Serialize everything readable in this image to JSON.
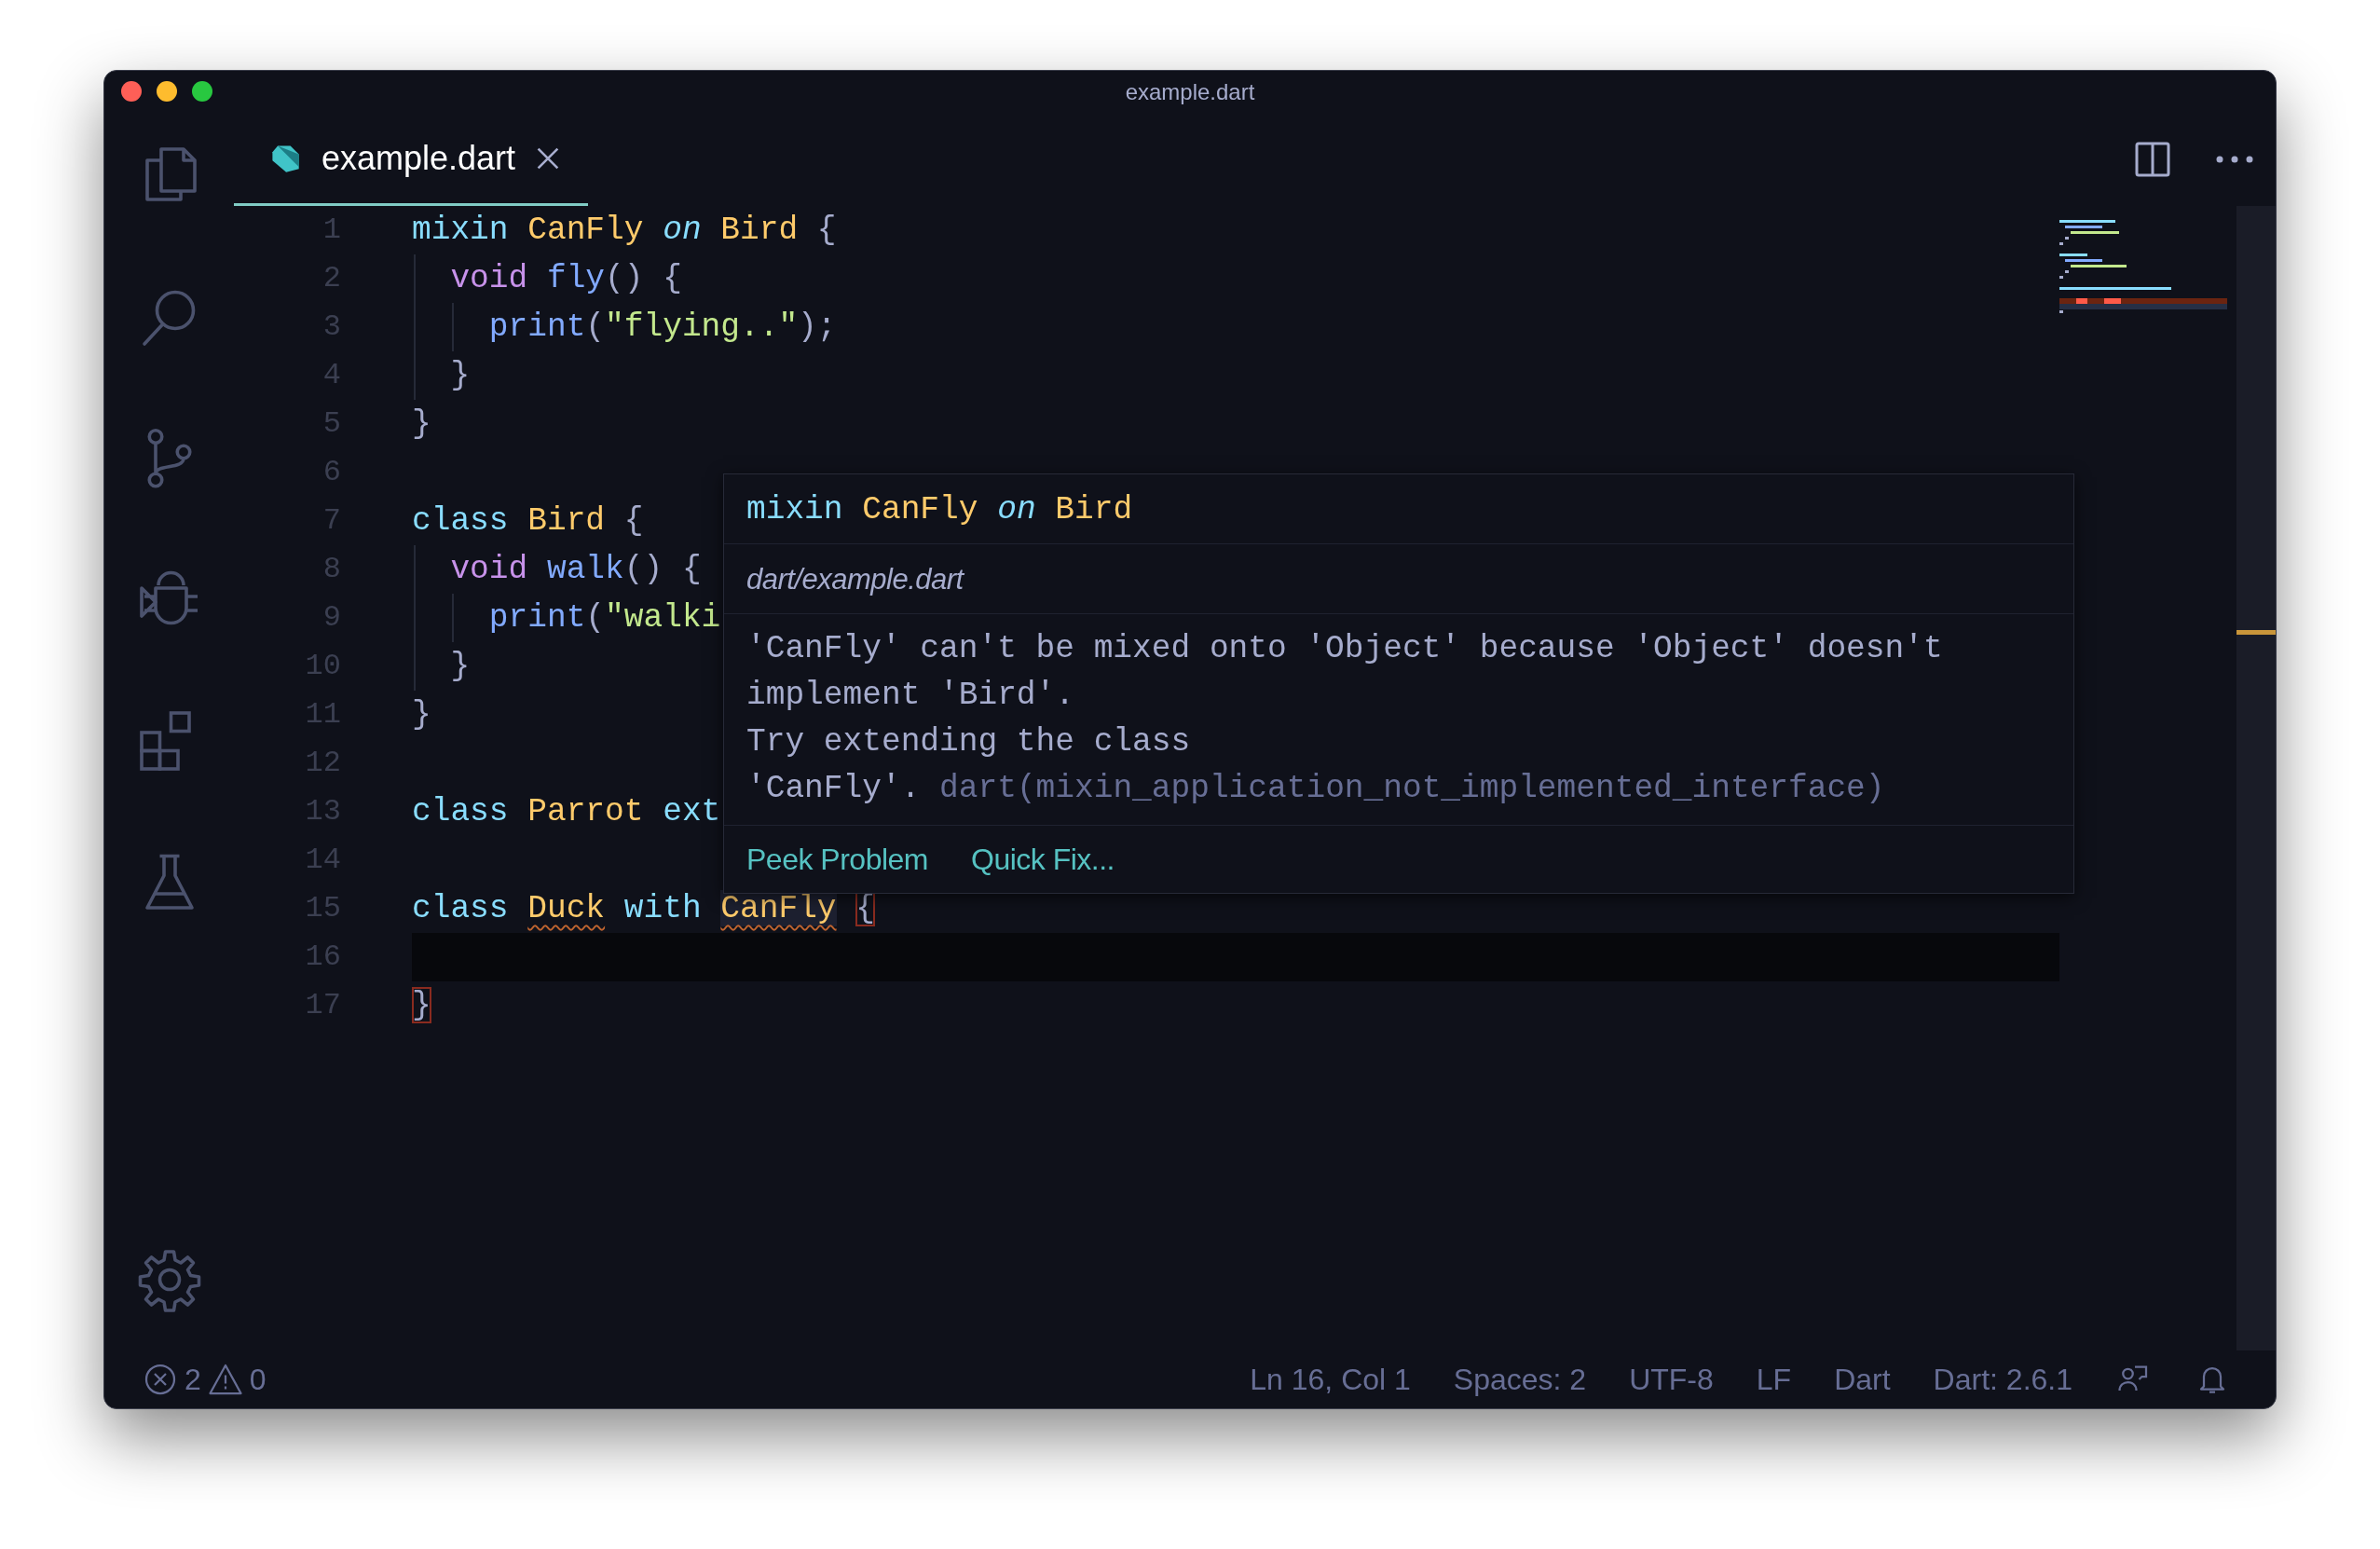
{
  "window": {
    "title": "example.dart"
  },
  "tabs": [
    {
      "label": "example.dart",
      "selected": true
    }
  ],
  "editor": {
    "lines": [
      {
        "number": "1",
        "current": false,
        "tokens": [
          {
            "t": "mixin ",
            "kind": "kw"
          },
          {
            "t": "CanFly ",
            "kind": "type"
          },
          {
            "t": "on",
            "kind": "mod"
          },
          {
            "t": " Bird",
            "kind": "type"
          },
          {
            "t": " {",
            "kind": "punct"
          }
        ]
      },
      {
        "number": "2",
        "current": false,
        "tokens": [
          {
            "t": "  void ",
            "kind": "void"
          },
          {
            "t": "fly",
            "kind": "fn"
          },
          {
            "t": "() {",
            "kind": "punct"
          }
        ]
      },
      {
        "number": "3",
        "current": false,
        "tokens": [
          {
            "t": "    print",
            "kind": "fn"
          },
          {
            "t": "(",
            "kind": "punct"
          },
          {
            "t": "\"flying..\"",
            "kind": "str"
          },
          {
            "t": ");",
            "kind": "punct"
          }
        ]
      },
      {
        "number": "4",
        "current": false,
        "tokens": [
          {
            "t": "  }",
            "kind": "punct"
          }
        ]
      },
      {
        "number": "5",
        "current": false,
        "tokens": [
          {
            "t": "}",
            "kind": "punct"
          }
        ]
      },
      {
        "number": "6",
        "current": false
      },
      {
        "number": "7",
        "current": false,
        "tokens": [
          {
            "t": "class ",
            "kind": "kw"
          },
          {
            "t": "Bird",
            "kind": "type"
          },
          {
            "t": " {",
            "kind": "punct"
          }
        ]
      },
      {
        "number": "8",
        "current": false,
        "tokens": [
          {
            "t": "  void ",
            "kind": "void"
          },
          {
            "t": "walk",
            "kind": "fn"
          },
          {
            "t": "() {",
            "kind": "punct"
          }
        ]
      },
      {
        "number": "9",
        "current": false,
        "tokens": [
          {
            "t": "    print",
            "kind": "fn"
          },
          {
            "t": "(",
            "kind": "punct"
          },
          {
            "t": "\"walki",
            "kind": "str"
          }
        ]
      },
      {
        "number": "10",
        "current": false,
        "tokens": [
          {
            "t": "  }",
            "kind": "punct"
          }
        ]
      },
      {
        "number": "11",
        "current": false,
        "tokens": [
          {
            "t": "}",
            "kind": "punct"
          }
        ]
      },
      {
        "number": "12",
        "current": false
      },
      {
        "number": "13",
        "current": false,
        "tokens": [
          {
            "t": "class ",
            "kind": "kw"
          },
          {
            "t": "Parrot ",
            "kind": "type"
          },
          {
            "t": "ext",
            "kind": "kw"
          }
        ]
      },
      {
        "number": "14",
        "current": false
      },
      {
        "number": "15",
        "current": false,
        "tokens": [
          {
            "t": "class ",
            "kind": "kw",
            "error": false,
            "hovered": false,
            "match": false
          },
          {
            "t": "Duck ",
            "kind": "type",
            "error": true,
            "hovered": false,
            "match": false
          },
          {
            "t": "with ",
            "kind": "kw",
            "error": false,
            "hovered": false,
            "match": false
          },
          {
            "t": "CanFly ",
            "kind": "type",
            "error": true,
            "hovered": true,
            "match": false
          },
          {
            "t": "{",
            "kind": "punct",
            "error": false,
            "hovered": false,
            "match": true
          }
        ]
      },
      {
        "number": "16",
        "current": true
      },
      {
        "number": "17",
        "current": false,
        "tokens": [
          {
            "t": "}",
            "kind": "punct",
            "error": false,
            "hovered": false,
            "match": true
          }
        ]
      }
    ]
  },
  "hover": {
    "signature": [
      {
        "t": "mixin ",
        "kind": "kw"
      },
      {
        "t": "CanFly ",
        "kind": "type"
      },
      {
        "t": "on",
        "kind": "mod"
      },
      {
        "t": " Bird",
        "kind": "type"
      }
    ],
    "path": "dart/example.dart",
    "message_lines": [
      "'CanFly' can't be mixed onto 'Object' because 'Object' doesn't",
      "implement 'Bird'.",
      "Try extending the class",
      "'CanFly'."
    ],
    "source": "dart(mixin_application_not_implemented_interface)",
    "actions": [
      "Peek Problem",
      "Quick Fix..."
    ]
  },
  "status_bar": {
    "errors": "2",
    "warnings": "0",
    "items": [
      "Ln 16, Col 1",
      "Spaces: 2",
      "UTF-8",
      "LF",
      "Dart",
      "Dart: 2.6.1"
    ]
  }
}
